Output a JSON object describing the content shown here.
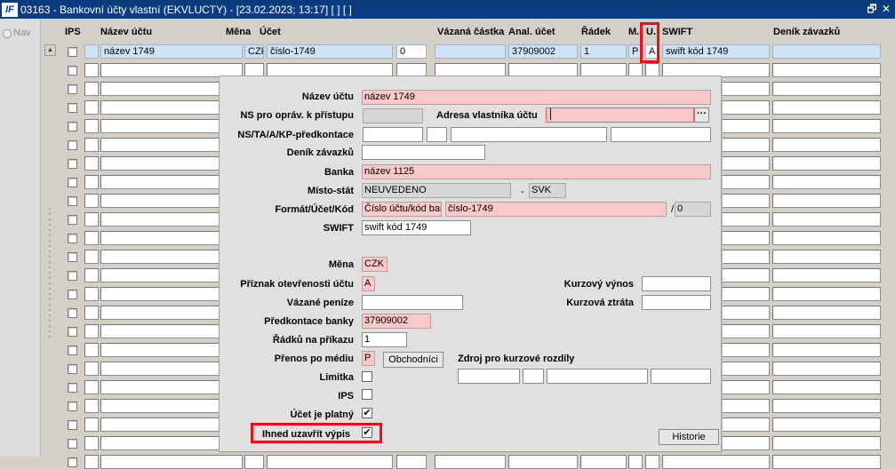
{
  "window": {
    "title": "03163 - Bankovní účty vlastní (EKVLUCTY) - [23.02.2023; 13:17] [ ] [ ]",
    "restore_glyph": "🗗",
    "close_glyph": "✕"
  },
  "nav": {
    "label": "Nav"
  },
  "grid": {
    "headers": {
      "ips": "IPS",
      "nazev_uctu": "Název účtu",
      "mena": "Měna",
      "ucet": "Účet",
      "vazana_castka": "Vázaná částka",
      "anal_ucet": "Anal. účet",
      "radek": "Řádek",
      "m": "M.",
      "u": "U.",
      "swift": "SWIFT",
      "denik": "Deník závazků"
    },
    "first_row": {
      "nazev": "název 1749",
      "mena": "CZK",
      "ucet": "číslo-1749",
      "vazana": "0",
      "anal": "37909002",
      "radek": "1",
      "m": "P",
      "u": "A",
      "swift": "swift kód 1749"
    }
  },
  "dialog": {
    "labels": {
      "nazev_uctu": "Název účtu",
      "ns_oprav": "NS pro opráv. k přístupu",
      "adresa": "Adresa vlastníka účtu",
      "ns_ta": "NS/TA/A/KP-předkontace",
      "denik": "Deník závazků",
      "banka": "Banka",
      "misto_stat": "Místo-stát",
      "format": "Formát/Účet/Kód",
      "swift": "SWIFT",
      "mena": "Měna",
      "priznak": "Příznak otevřenosti účtu",
      "vazane": "Vázané peníze",
      "predkontace": "Předkontace banky",
      "radku": "Řádků na příkazu",
      "prenos": "Přenos po médiu",
      "limitka": "Limitka",
      "ips": "IPS",
      "ucet_platny": "Účet je platný",
      "ihned": "Ihned uzavřít výpis",
      "kurz_vynos": "Kurzový výnos",
      "kurz_ztrata": "Kurzová ztráta",
      "zdroj": "Zdroj pro kurzové rozdíly"
    },
    "values": {
      "nazev_uctu": "název 1749",
      "banka": "název 1125",
      "misto": "NEUVEDENO",
      "misto_sep": "-",
      "stat": "SVK",
      "format": "Číslo účtu/kód bar",
      "ucet": "číslo-1749",
      "kod_sep": "/",
      "kod": "0",
      "swift": "swift kód 1749",
      "mena": "CZK",
      "priznak": "A",
      "predkontace": "37909002",
      "radku": "1",
      "prenos": "P",
      "ellipsis": "···"
    },
    "checks": {
      "ucet_platny": "✔",
      "ihned": "✔"
    },
    "buttons": {
      "obchodnici": "Obchodníci",
      "historie": "Historie"
    }
  }
}
